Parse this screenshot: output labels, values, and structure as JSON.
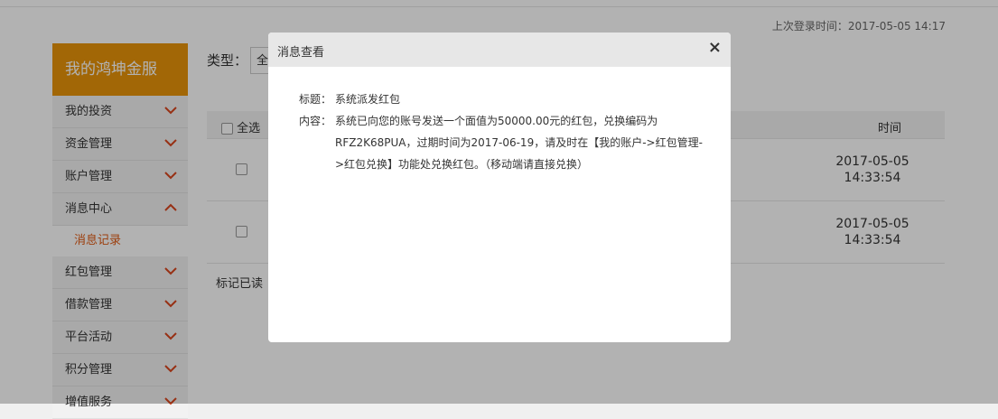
{
  "header": {
    "last_login": "上次登录时间：2017-05-05 14:17"
  },
  "sidebar": {
    "title": "我的鸿坤金服",
    "items": [
      {
        "label": "我的投资"
      },
      {
        "label": "资金管理"
      },
      {
        "label": "账户管理"
      },
      {
        "label": "消息中心"
      },
      {
        "label": "红包管理"
      },
      {
        "label": "借款管理"
      },
      {
        "label": "平台活动"
      },
      {
        "label": "积分管理"
      },
      {
        "label": "增值服务"
      }
    ],
    "sub_item": "消息记录"
  },
  "filter": {
    "type_label": "类型：",
    "type_value": "全"
  },
  "table": {
    "select_all": "全选",
    "col_time": "时间",
    "rows": [
      {
        "time_date": "2017-05-05",
        "time_clock": "14:33:54"
      },
      {
        "time_date": "2017-05-05",
        "time_clock": "14:33:54"
      }
    ],
    "mark_read": "标记已读"
  },
  "modal": {
    "title": "消息查看",
    "close": "×",
    "subject_label": "标题：",
    "subject": "系统派发红包",
    "content_label": "内容：",
    "content": "系统已向您的账号发送一个面值为50000.00元的红包，兑换编码为RFZ2K68PUA，过期时间为2017-06-19，请及时在【我的账户->红包管理->红包兑换】功能处兑换红包。（移动端请直接兑换）"
  },
  "colors": {
    "brand": "#e8940a",
    "accent_text": "#e05a14",
    "chevron": "#d9461d"
  }
}
